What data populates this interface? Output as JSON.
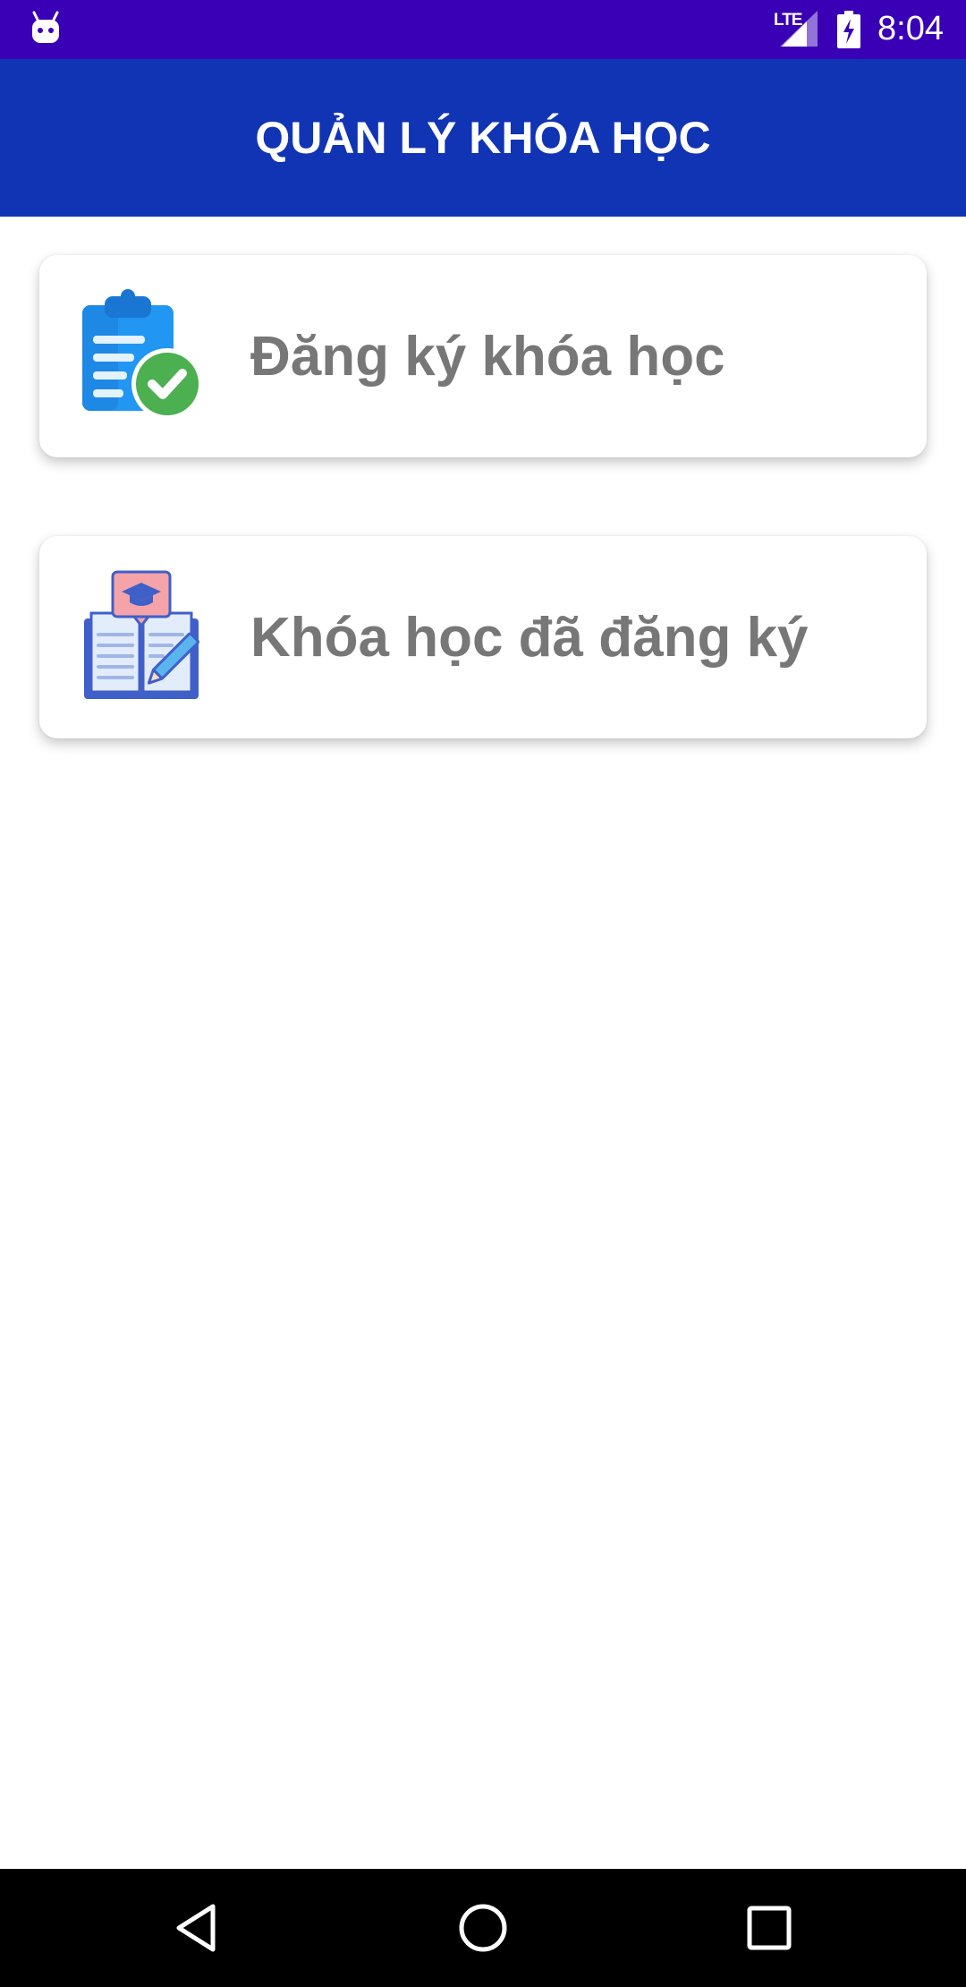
{
  "status_bar": {
    "time": "8:04",
    "network_type": "LTE",
    "icons": [
      "android-icon",
      "signal-icon",
      "battery-charging-icon"
    ]
  },
  "app_bar": {
    "title": "QUẢN LÝ KHÓA HỌC",
    "color": "#1034b4"
  },
  "menu": {
    "items": [
      {
        "label": "Đăng ký khóa học",
        "icon": "clipboard-check-icon"
      },
      {
        "label": "Khóa học đã đăng ký",
        "icon": "open-book-graduation-icon"
      }
    ]
  },
  "nav_bar": {
    "buttons": [
      "back-icon",
      "home-icon",
      "recents-icon"
    ]
  },
  "colors": {
    "status_bar": "#3a00b6",
    "app_bar": "#1034b4",
    "label_text": "#777777"
  }
}
